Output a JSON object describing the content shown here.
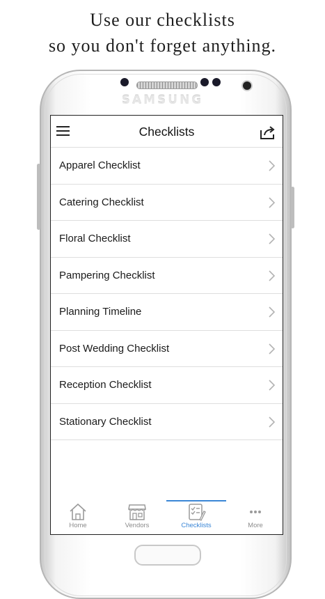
{
  "promo": {
    "line1": "Use our checklists",
    "line2": "so you don't forget anything."
  },
  "device": {
    "brand": "SAMSUNG"
  },
  "header": {
    "title": "Checklists",
    "menu_icon": "hamburger-menu-icon",
    "share_icon": "share-icon"
  },
  "checklists": [
    {
      "label": "Apparel Checklist"
    },
    {
      "label": "Catering Checklist"
    },
    {
      "label": "Floral Checklist"
    },
    {
      "label": "Pampering Checklist"
    },
    {
      "label": "Planning Timeline"
    },
    {
      "label": "Post Wedding Checklist"
    },
    {
      "label": "Reception Checklist"
    },
    {
      "label": "Stationary Checklist"
    }
  ],
  "tabs": [
    {
      "label": "Home",
      "icon": "home-icon"
    },
    {
      "label": "Vendors",
      "icon": "storefront-icon"
    },
    {
      "label": "Checklists",
      "icon": "checklist-icon",
      "active": true
    },
    {
      "label": "More",
      "icon": "more-dots-icon"
    }
  ],
  "colors": {
    "accent": "#3a86d6",
    "text": "#1a1a1a",
    "divider": "#dedede"
  }
}
